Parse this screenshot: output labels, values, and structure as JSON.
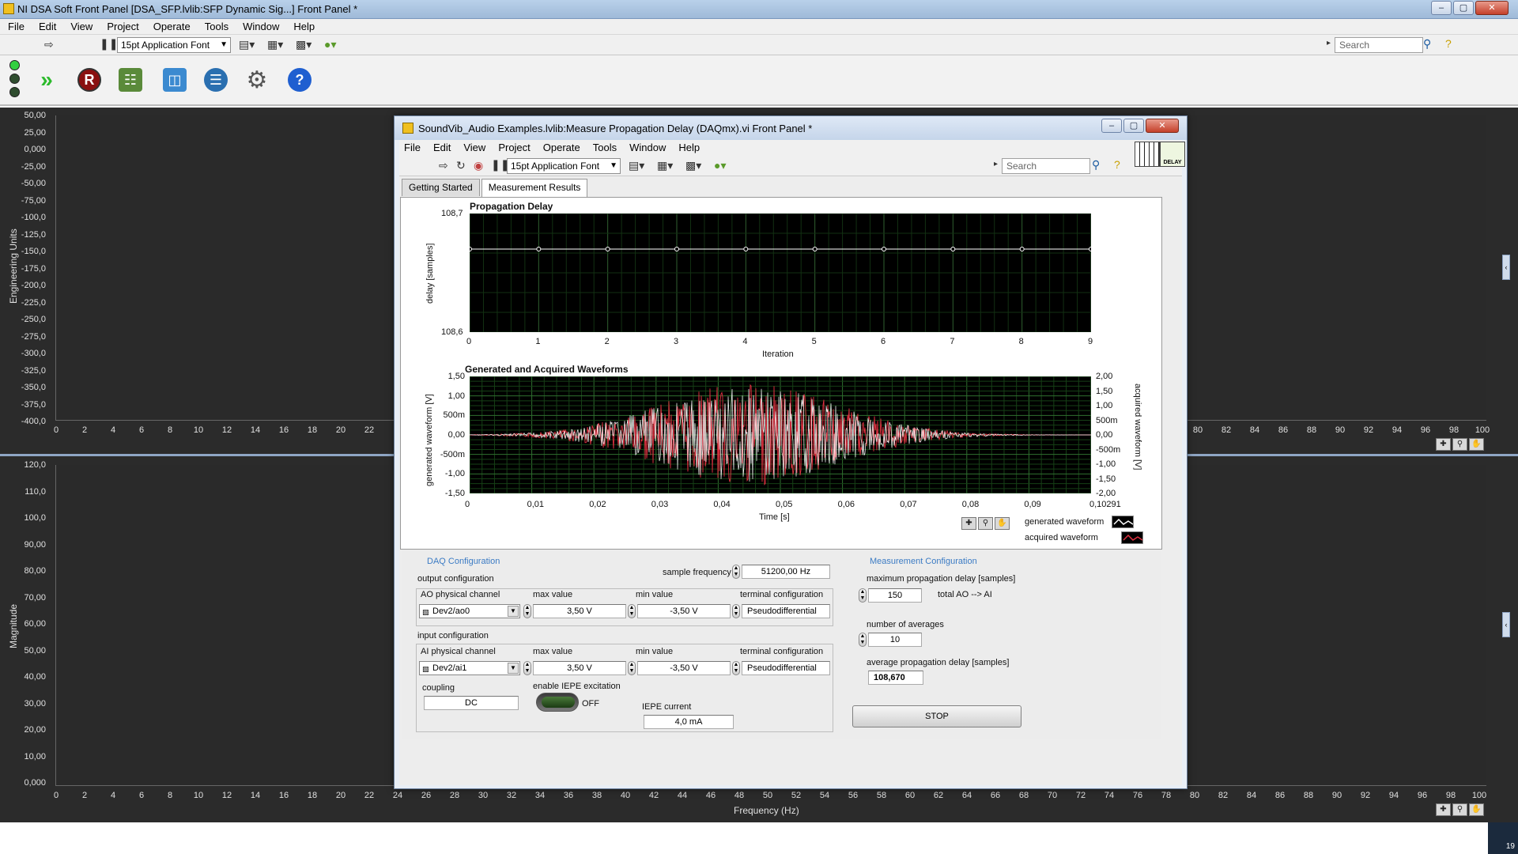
{
  "outer": {
    "title": "NI DSA Soft Front Panel [DSA_SFP.lvlib:SFP Dynamic Sig...] Front Panel *",
    "menu": [
      "File",
      "Edit",
      "View",
      "Project",
      "Operate",
      "Tools",
      "Window",
      "Help"
    ],
    "font_selector": "15pt Application Font",
    "search_placeholder": "Search",
    "big_toolbar_icons": [
      "led-status-icon",
      "run-continuous-icon",
      "record-icon",
      "configure-device-icon",
      "storage-icon",
      "database-icon",
      "settings-gear-icon",
      "help-icon"
    ],
    "record_glyph": "R",
    "help_glyph": "?",
    "top_graph": {
      "ylabel": "Engineering Units",
      "yticks": [
        "50,00",
        "25,00",
        "0,000",
        "-25,00",
        "-50,00",
        "-75,00",
        "-100,0",
        "-125,0",
        "-150,0",
        "-175,0",
        "-200,0",
        "-225,0",
        "-250,0",
        "-275,0",
        "-300,0",
        "-325,0",
        "-350,0",
        "-375,0",
        "-400,0"
      ],
      "xticks_left": [
        "0",
        "2",
        "4",
        "6",
        "8",
        "10",
        "12",
        "14",
        "16",
        "18",
        "20",
        "22"
      ],
      "xticks_right": [
        "80",
        "82",
        "84",
        "86",
        "88",
        "90",
        "92",
        "94",
        "96",
        "98",
        "100"
      ]
    },
    "bottom_graph": {
      "ylabel": "Magnitude",
      "xlabel": "Frequency (Hz)",
      "yticks": [
        "120,0",
        "110,0",
        "100,0",
        "90,00",
        "80,00",
        "70,00",
        "60,00",
        "50,00",
        "40,00",
        "30,00",
        "20,00",
        "10,00",
        "0,000"
      ],
      "xticks": [
        "0",
        "2",
        "4",
        "6",
        "8",
        "10",
        "12",
        "14",
        "16",
        "18",
        "20",
        "22",
        "24",
        "26",
        "28",
        "30",
        "32",
        "34",
        "36",
        "38",
        "40",
        "42",
        "44",
        "46",
        "48",
        "50",
        "52",
        "54",
        "56",
        "58",
        "60",
        "62",
        "64",
        "66",
        "68",
        "70",
        "72",
        "74",
        "76",
        "78",
        "80",
        "82",
        "84",
        "86",
        "88",
        "90",
        "92",
        "94",
        "96",
        "98",
        "100"
      ]
    },
    "tray_text": "19"
  },
  "child": {
    "title": "SoundVib_Audio Examples.lvlib:Measure Propagation Delay (DAQmx).vi Front Panel *",
    "menu": [
      "File",
      "Edit",
      "View",
      "Project",
      "Operate",
      "Tools",
      "Window",
      "Help"
    ],
    "font_selector": "15pt Application Font",
    "search_placeholder": "Search",
    "delay_icon_label": "DELAY",
    "tabs": [
      "Getting Started",
      "Measurement Results"
    ],
    "active_tab": 1,
    "propagation_plot": {
      "title": "Propagation Delay",
      "ylabel": "delay [samples]",
      "xlabel": "Iteration",
      "ytop": "108,7",
      "ybottom": "108,6",
      "xticks": [
        "0",
        "1",
        "2",
        "3",
        "4",
        "5",
        "6",
        "7",
        "8",
        "9"
      ]
    },
    "waveform_plot": {
      "title": "Generated and Acquired Waveforms",
      "ylabel_left": "generated waveform [V]",
      "ylabel_right": "acquired waveform [V]",
      "xlabel": "Time [s]",
      "yticks_left": [
        "1,50",
        "1,00",
        "500m",
        "0,00",
        "-500m",
        "-1,00",
        "-1,50"
      ],
      "yticks_right": [
        "2,00",
        "1,50",
        "1,00",
        "500m",
        "0,00",
        "-500m",
        "-1,00",
        "-1,50",
        "-2,00"
      ],
      "xticks": [
        "0",
        "0,01",
        "0,02",
        "0,03",
        "0,04",
        "0,05",
        "0,06",
        "0,07",
        "0,08",
        "0,09",
        "0,10291"
      ],
      "legend": [
        "generated waveform",
        "acquired waveform"
      ]
    },
    "daq": {
      "section_title": "DAQ Configuration",
      "sample_frequency_label": "sample frequency",
      "sample_frequency": "51200,00 Hz",
      "output_configuration": "output configuration",
      "input_configuration": "input configuration",
      "ao_channel_label": "AO physical channel",
      "ao_channel": "Dev2/ao0",
      "ai_channel_label": "AI physical channel",
      "ai_channel": "Dev2/ai1",
      "max_value_label": "max value",
      "min_value_label": "min value",
      "terminal_label": "terminal configuration",
      "out_max": "3,50 V",
      "out_min": "-3,50 V",
      "out_terminal": "Pseudodifferential",
      "in_max": "3,50 V",
      "in_min": "-3,50 V",
      "in_terminal": "Pseudodifferential",
      "coupling_label": "coupling",
      "coupling": "DC",
      "iepe_excitation_label": "enable IEPE excitation",
      "iepe_excitation": "OFF",
      "iepe_current_label": "IEPE current",
      "iepe_current": "4,0 mA"
    },
    "measurement": {
      "section_title": "Measurement Configuration",
      "max_delay_label": "maximum propagation delay [samples]",
      "max_delay": "150",
      "max_delay_unit": "total AO --> AI",
      "averages_label": "number of averages",
      "averages": "10",
      "avg_delay_label": "average propagation delay [samples]",
      "avg_delay": "108,670",
      "stop_label": "STOP"
    }
  }
}
